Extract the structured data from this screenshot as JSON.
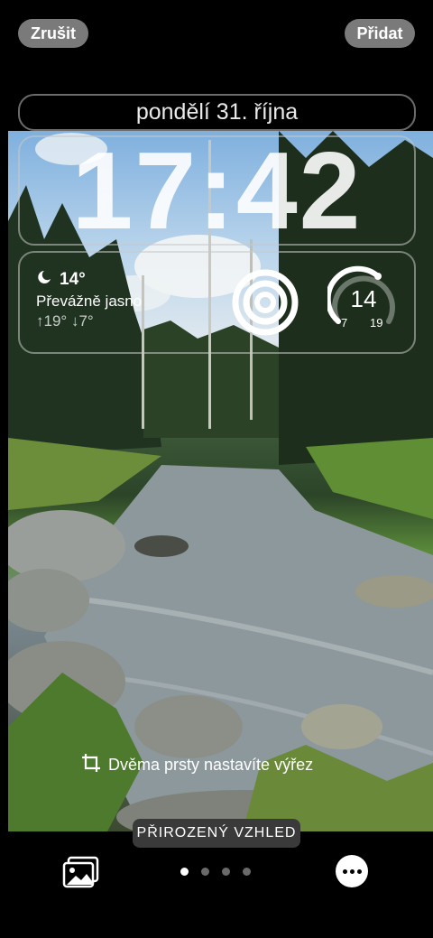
{
  "top_bar": {
    "cancel_label": "Zrušit",
    "add_label": "Přidat"
  },
  "lock_screen": {
    "date": "pondělí 31. října",
    "time": "17:42",
    "weather": {
      "icon": "moon-cloud-icon",
      "temperature": "14°",
      "condition": "Převážně jasno",
      "high": "↑19°",
      "low": "↓7°"
    },
    "gauge": {
      "value": "14",
      "min": "7",
      "max": "19"
    }
  },
  "hint_text": "Dvěma prsty nastavíte výřez",
  "style_label": "PŘIROZENÝ VZHLED",
  "page_dots": {
    "count": 4,
    "active_index": 0
  },
  "colors": {
    "background": "#000000",
    "button_gray": "#7a7a7a",
    "label_bg": "#3a3a3a"
  }
}
